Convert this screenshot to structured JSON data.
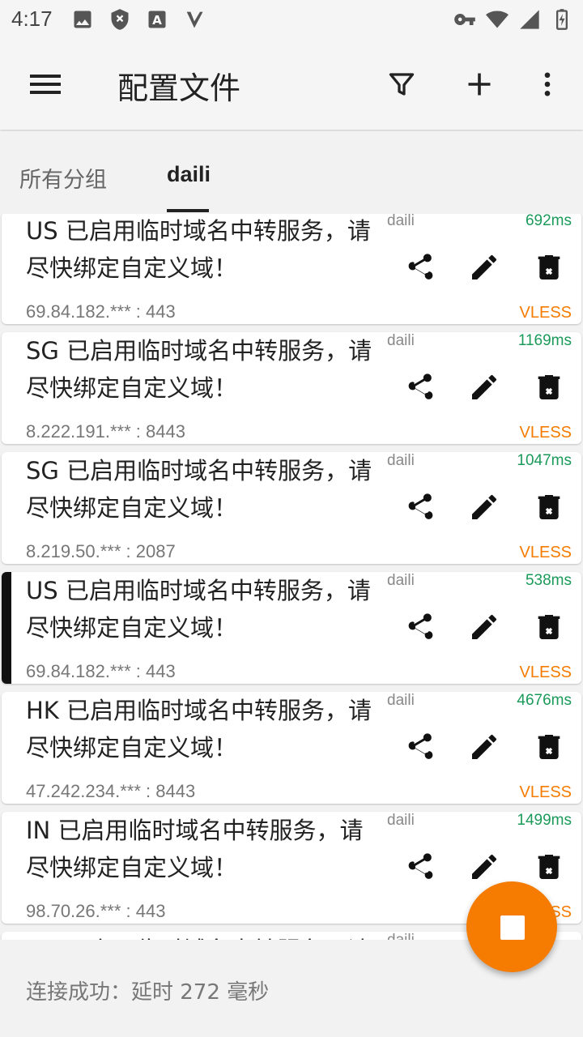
{
  "status_bar": {
    "time": "4:17",
    "left_icons": [
      "image-icon",
      "shield-icon",
      "font-a-icon",
      "vpn-v-icon"
    ],
    "right_icons": [
      "key-icon",
      "wifi-icon",
      "signal-icon",
      "battery-charging-icon"
    ]
  },
  "app_bar": {
    "title": "配置文件",
    "actions": [
      "filter-icon",
      "add-icon",
      "more-vert-icon"
    ]
  },
  "tabs": [
    {
      "label": "所有分组",
      "selected": false
    },
    {
      "label": "daili",
      "selected": true
    }
  ],
  "servers": [
    {
      "title": "US 已启用临时域名中转服务，请尽快绑定自定义域！",
      "group": "daili",
      "latency": "692ms",
      "address": "69.84.182.*** : 443",
      "type": "VLESS",
      "selected": false
    },
    {
      "title": "SG 已启用临时域名中转服务，请尽快绑定自定义域！",
      "group": "daili",
      "latency": "1169ms",
      "address": "8.222.191.*** : 8443",
      "type": "VLESS",
      "selected": false
    },
    {
      "title": "SG 已启用临时域名中转服务，请尽快绑定自定义域！",
      "group": "daili",
      "latency": "1047ms",
      "address": "8.219.50.*** : 2087",
      "type": "VLESS",
      "selected": false
    },
    {
      "title": "US 已启用临时域名中转服务，请尽快绑定自定义域！",
      "group": "daili",
      "latency": "538ms",
      "address": "69.84.182.*** : 443",
      "type": "VLESS",
      "selected": true
    },
    {
      "title": "HK 已启用临时域名中转服务，请尽快绑定自定义域！",
      "group": "daili",
      "latency": "4676ms",
      "address": "47.242.234.*** : 8443",
      "type": "VLESS",
      "selected": false
    },
    {
      "title": "IN 已启用临时域名中转服务，请尽快绑定自定义域！",
      "group": "daili",
      "latency": "1499ms",
      "address": "98.70.26.*** : 443",
      "type": "VLESS",
      "selected": false
    },
    {
      "title": "US 已启用临时域名中转服务，请尽快绑定自定义域！",
      "group": "daili",
      "latency": "",
      "address": "",
      "type": "",
      "selected": false
    }
  ],
  "bottom_status": "连接成功：延时 272 毫秒",
  "fab": {
    "icon": "stop-icon",
    "color": "#f57c00"
  },
  "colors": {
    "latency": "#1b9a5a",
    "type": "#f57c00",
    "accent": "#f57c00"
  }
}
